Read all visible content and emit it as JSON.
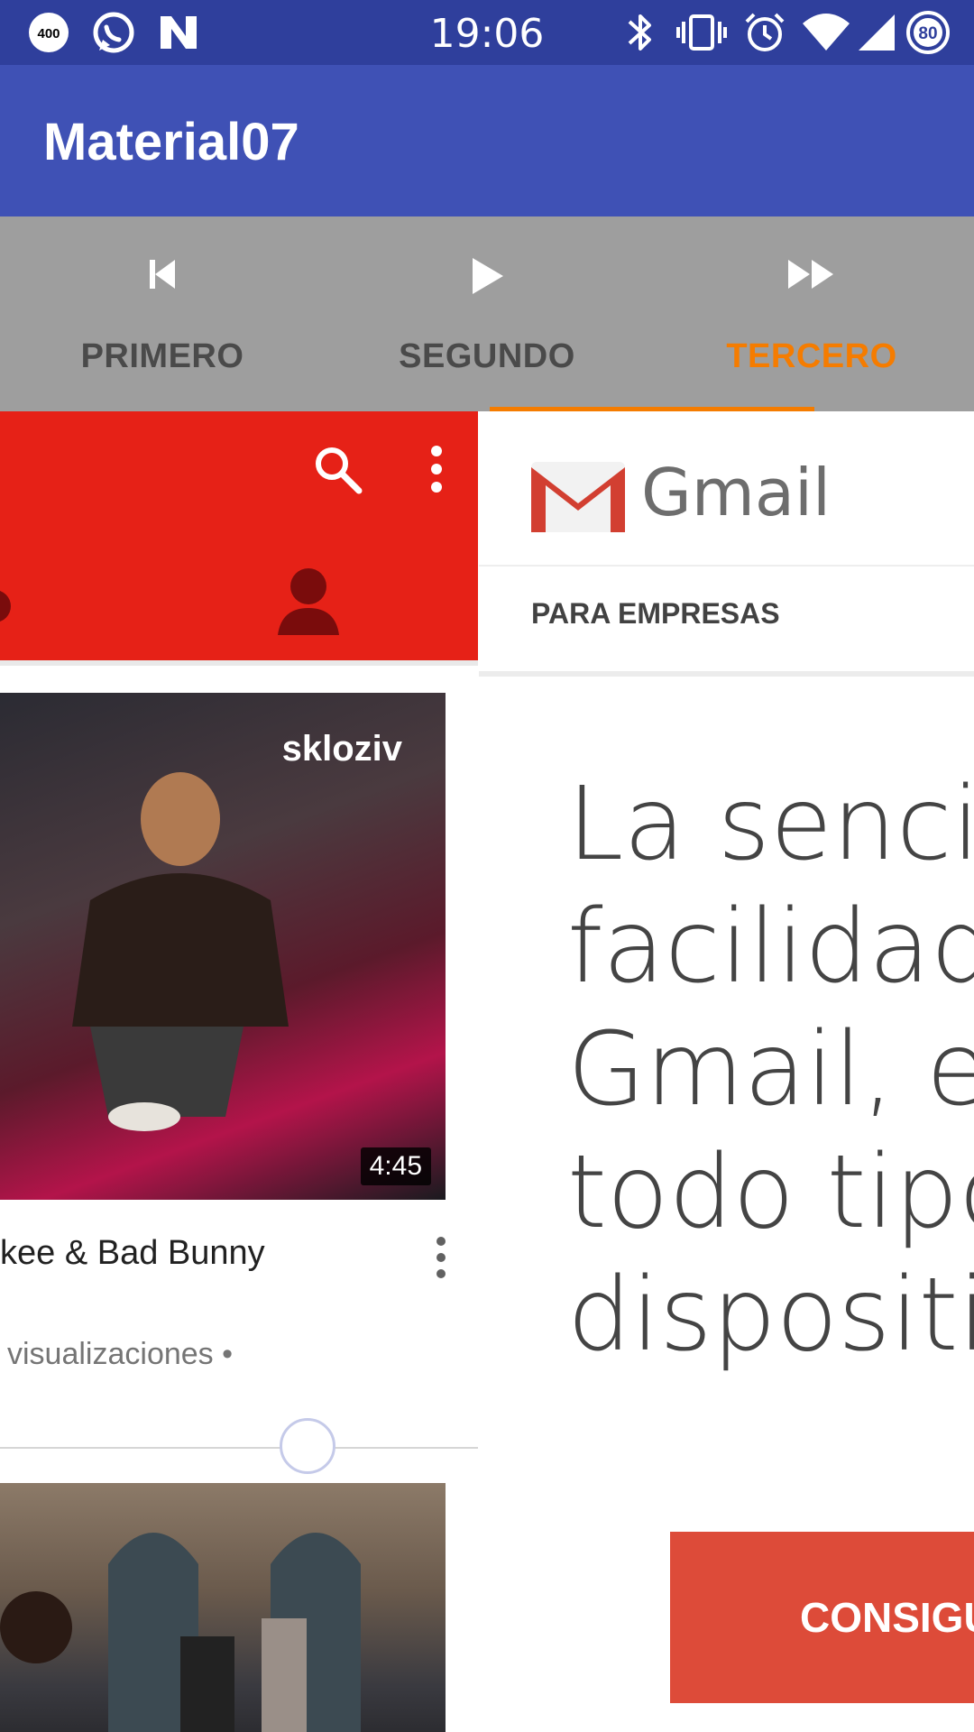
{
  "status_bar": {
    "time": "19:06",
    "battery_level": "80",
    "notification_badge": "400",
    "icons": [
      "badge-400-icon",
      "whatsapp-icon",
      "n-app-icon",
      "bluetooth-icon",
      "vibrate-icon",
      "alarm-icon",
      "wifi-icon",
      "signal-icon",
      "battery-icon"
    ]
  },
  "app_bar": {
    "title": "Material07"
  },
  "tabs": [
    {
      "label": "PRIMERO",
      "icon": "skip-previous-icon",
      "active": false
    },
    {
      "label": "SEGUNDO",
      "icon": "play-icon",
      "active": false
    },
    {
      "label": "TERCERO",
      "icon": "fast-forward-icon",
      "active": true
    }
  ],
  "colors": {
    "status_bar": "#2f3f9c",
    "app_bar": "#3f51b5",
    "tabs": "#9e9e9e",
    "accent": "#f57c00",
    "youtube_red": "#e62117",
    "gmail_cta": "#dd4b39"
  },
  "youtube_panel": {
    "video": {
      "brand": "skloziv",
      "duration": "4:45",
      "title": "kee & Bad Bunny",
      "meta": "visualizaciones •"
    }
  },
  "gmail_panel": {
    "logo_text": "Gmail",
    "subheader": "PARA EMPRESAS",
    "hero_lines": [
      "La sencille",
      "facilidad c",
      "Gmail, en",
      "todo tipo",
      "dispositiv"
    ],
    "cta_label": "CONSIGU"
  }
}
